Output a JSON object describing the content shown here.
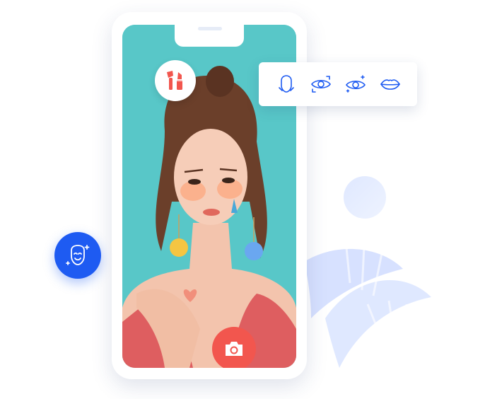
{
  "colors": {
    "accent_blue": "#1e5bf2",
    "camera_red": "#f2564e",
    "screen_bg": "#56c6c7",
    "deco_blue": "#dfe8ff"
  },
  "phone": {
    "top_button_icon": "makeup-brush-lipstick-icon",
    "capture_button_icon": "camera-icon"
  },
  "feature_toolbar": {
    "items": [
      {
        "icon": "face-shape-icon"
      },
      {
        "icon": "eye-enlarge-icon"
      },
      {
        "icon": "eye-sparkle-icon"
      },
      {
        "icon": "lips-icon"
      }
    ]
  },
  "beauty_button": {
    "icon": "smiling-face-sparkle-icon"
  }
}
